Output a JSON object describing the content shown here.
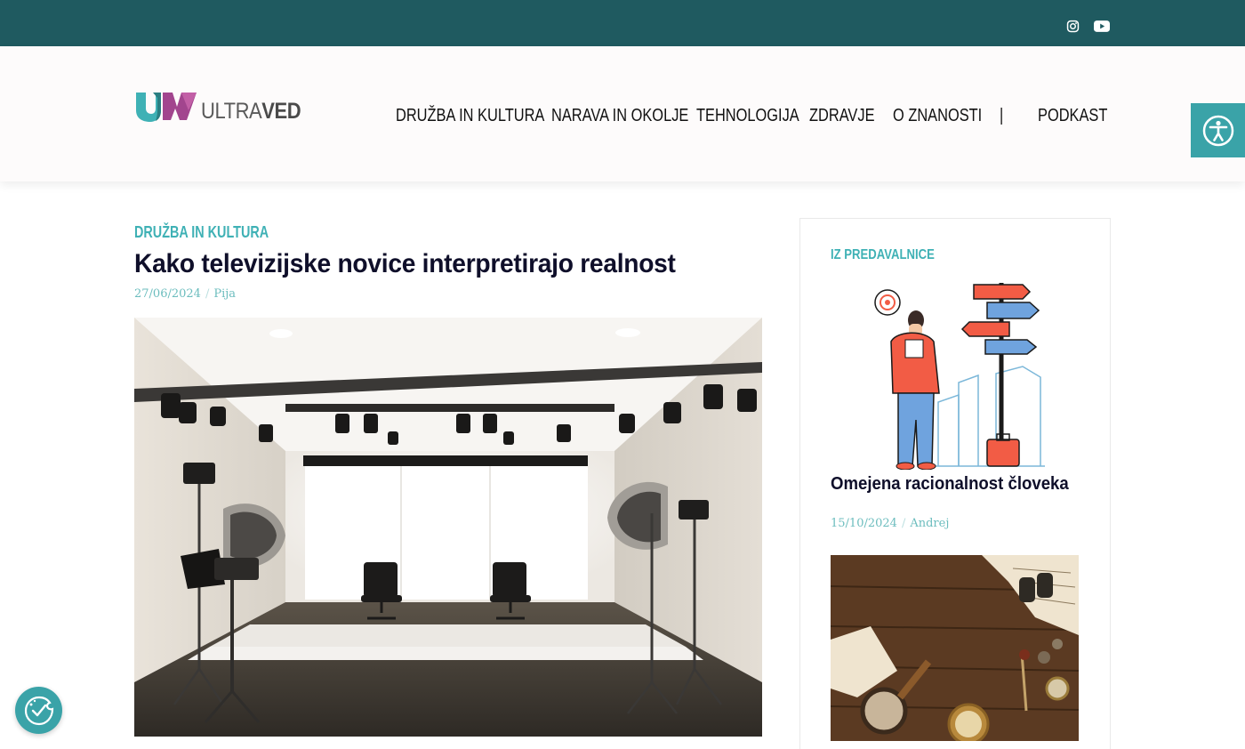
{
  "topbar": {
    "social_icons": [
      "instagram-icon",
      "youtube-icon"
    ],
    "background": "#1f5a60"
  },
  "header": {
    "logo": {
      "text_light": "ULTRA",
      "text_bold": "VED"
    },
    "nav": [
      {
        "label": "DRUŽBA IN KULTURA"
      },
      {
        "label": "NARAVA IN OKOLJE"
      },
      {
        "label": "TEHNOLOGIJA"
      },
      {
        "label": "ZDRAVJE"
      },
      {
        "label": "O ZNANOSTI"
      },
      {
        "label": "|"
      },
      {
        "label": "PODKAST"
      }
    ]
  },
  "accessibility": {
    "icon": "accessibility-icon"
  },
  "article": {
    "category": "DRUŽBA IN KULTURA",
    "title": "Kako televizijske novice interpretirajo realnost",
    "date": "27/06/2024",
    "separator": "/",
    "author": "Pija",
    "image": "tv-studio-photo"
  },
  "sidebar": {
    "heading": "IZ PREDAVALNICE",
    "posts": [
      {
        "title": "Omejena racionalnost človeka",
        "date": "15/10/2024",
        "separator": "/",
        "author": "Andrej",
        "image": "decision-signpost-illustration"
      },
      {
        "image": "vintage-desk-photo"
      }
    ]
  },
  "cookie": {
    "icon": "cookie-consent-icon"
  },
  "colors": {
    "accent": "#3fb1b5",
    "dark_teal": "#1f5a60",
    "title": "#0f0f2a"
  }
}
